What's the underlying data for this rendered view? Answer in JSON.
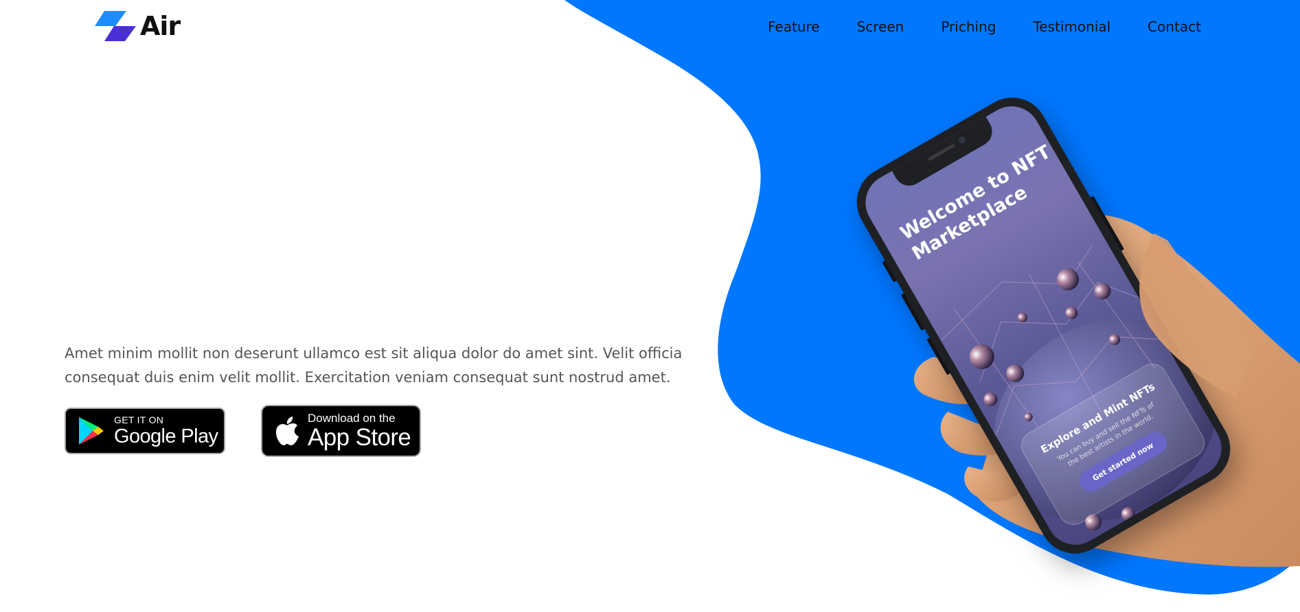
{
  "brand": {
    "name": "Air",
    "icon": "air-logo-icon"
  },
  "nav": {
    "items": [
      {
        "label": "Feature"
      },
      {
        "label": "Screen"
      },
      {
        "label": "Priching"
      },
      {
        "label": "Testimonial"
      },
      {
        "label": "Contact"
      }
    ]
  },
  "hero": {
    "description": "Amet minim mollit non deserunt ullamco est sit aliqua dolor do amet sint. Velit officia consequat duis enim velit mollit. Exercitation veniam consequat sunt nostrud amet."
  },
  "stores": {
    "google": {
      "small": "GET IT ON",
      "big": "Google Play",
      "icon": "google-play-icon"
    },
    "apple": {
      "small": "Download on the",
      "big": "App Store",
      "icon": "apple-icon"
    }
  },
  "phone_screen": {
    "title": "Welcome to NFT Marketplace",
    "card_title": "Explore and Mint NFTs",
    "card_subtitle": "You can buy and sell the NFTs of the best artists in the world.",
    "cta": "Get started now"
  },
  "colors": {
    "accent_blue": "#0077ff",
    "logo_light": "#1e8cff",
    "logo_dark": "#4a2fd6",
    "text_dark": "#111111",
    "text_body": "#555555"
  }
}
